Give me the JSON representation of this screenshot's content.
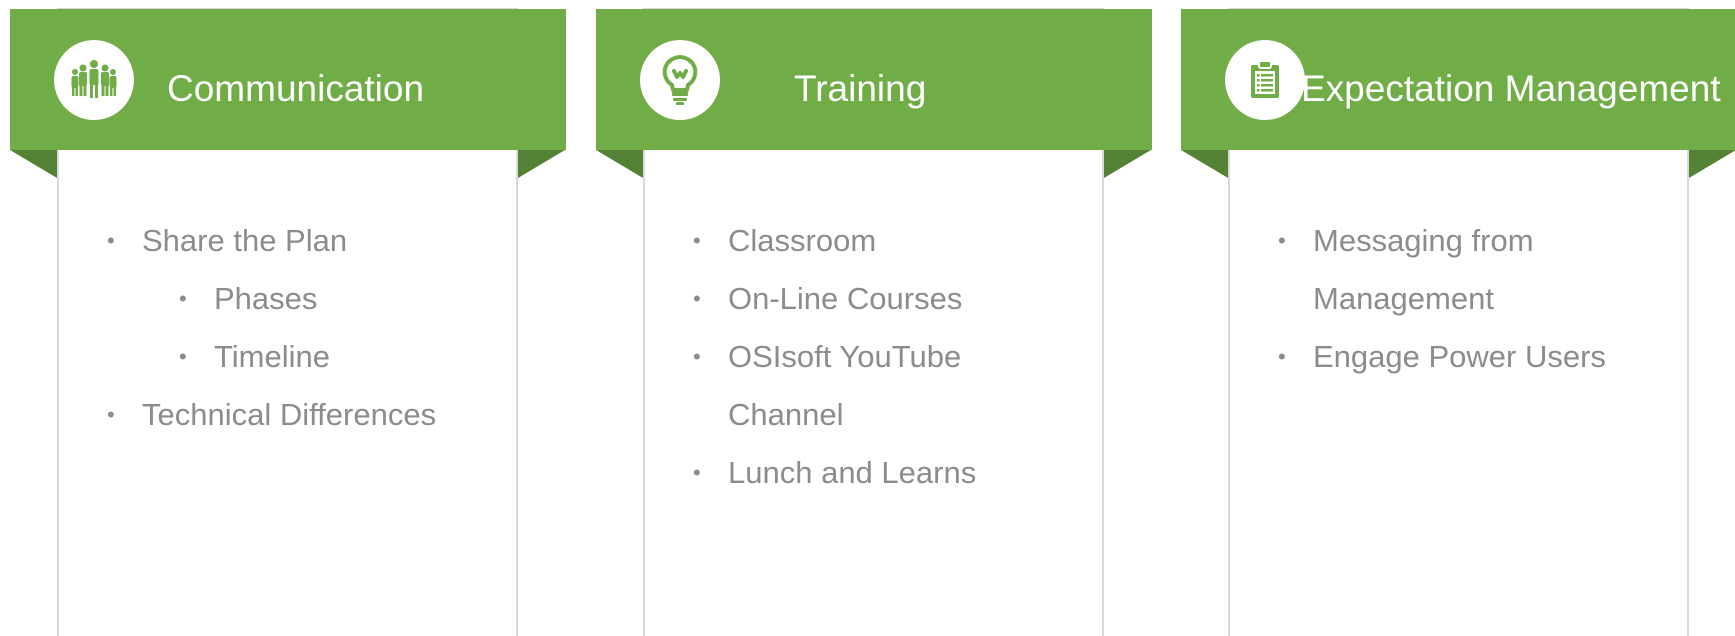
{
  "panels": [
    {
      "title": "Communication",
      "icon": "team-icon",
      "items": [
        {
          "text": "Share the Plan",
          "level": 1
        },
        {
          "text": "Phases",
          "level": 2
        },
        {
          "text": "Timeline",
          "level": 2
        },
        {
          "text": "Technical Differences",
          "level": 1
        }
      ]
    },
    {
      "title": "Training",
      "icon": "lightbulb-icon",
      "items": [
        {
          "text": "Classroom",
          "level": 1
        },
        {
          "text": "On-Line Courses",
          "level": 1
        },
        {
          "text": "OSIsoft YouTube Channel",
          "level": 1
        },
        {
          "text": "Lunch and Learns",
          "level": 1
        }
      ]
    },
    {
      "title": "Expectation Management",
      "icon": "clipboard-icon",
      "items": [
        {
          "text": "Messaging from Management",
          "level": 1
        },
        {
          "text": "Engage Power Users",
          "level": 1
        }
      ]
    }
  ],
  "colors": {
    "ribbon": "#70ad47",
    "fold": "#548235",
    "text": "#8c8c8c",
    "card_border": "#d9d9d9"
  }
}
